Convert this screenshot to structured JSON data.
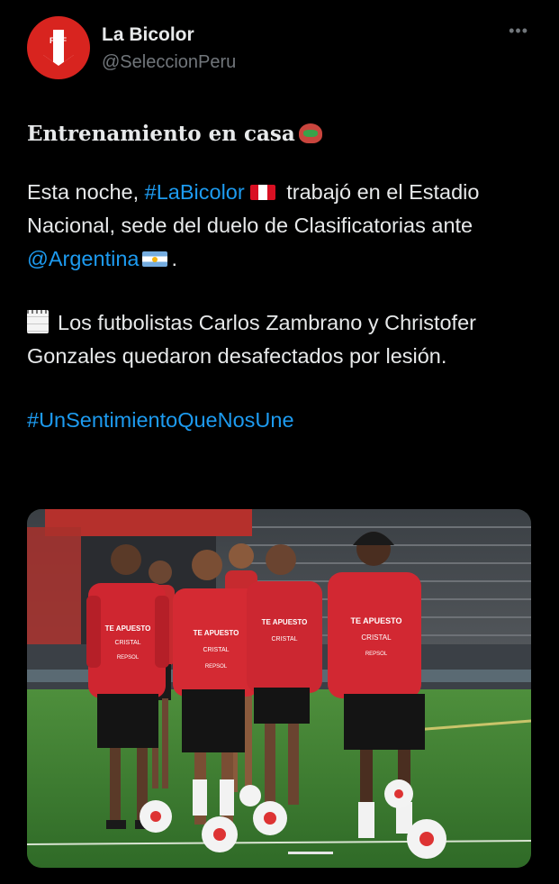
{
  "account": {
    "name": "La Bicolor",
    "handle": "@SeleccionPeru",
    "avatar_text": "FPF",
    "more_icon": "more-horizontal-icon"
  },
  "tweet": {
    "title": "Entrenamiento en casa",
    "p1_a": "Esta noche, ",
    "p1_hashtag": "#LaBicolor",
    "p1_b": " trabajó en el Estadio Nacional, sede del duelo de Clasificatorias  ante ",
    "p1_mention": "@Argentina",
    "p1_c": ".",
    "p2": "Los futbolistas Carlos Zambrano y Christofer Gonzales quedaron desafectados por lesión.",
    "hashtag2": "#UnSentimientoQueNosUne"
  },
  "colors": {
    "background": "#000000",
    "text": "#e7e9ea",
    "secondary": "#71767b",
    "link": "#1d9bf0",
    "brand_red": "#d8241f"
  },
  "media": {
    "kit_sponsor_1": "TE APUESTO",
    "kit_sponsor_2": "CRISTAL",
    "kit_sponsor_3": "REPSOL"
  }
}
